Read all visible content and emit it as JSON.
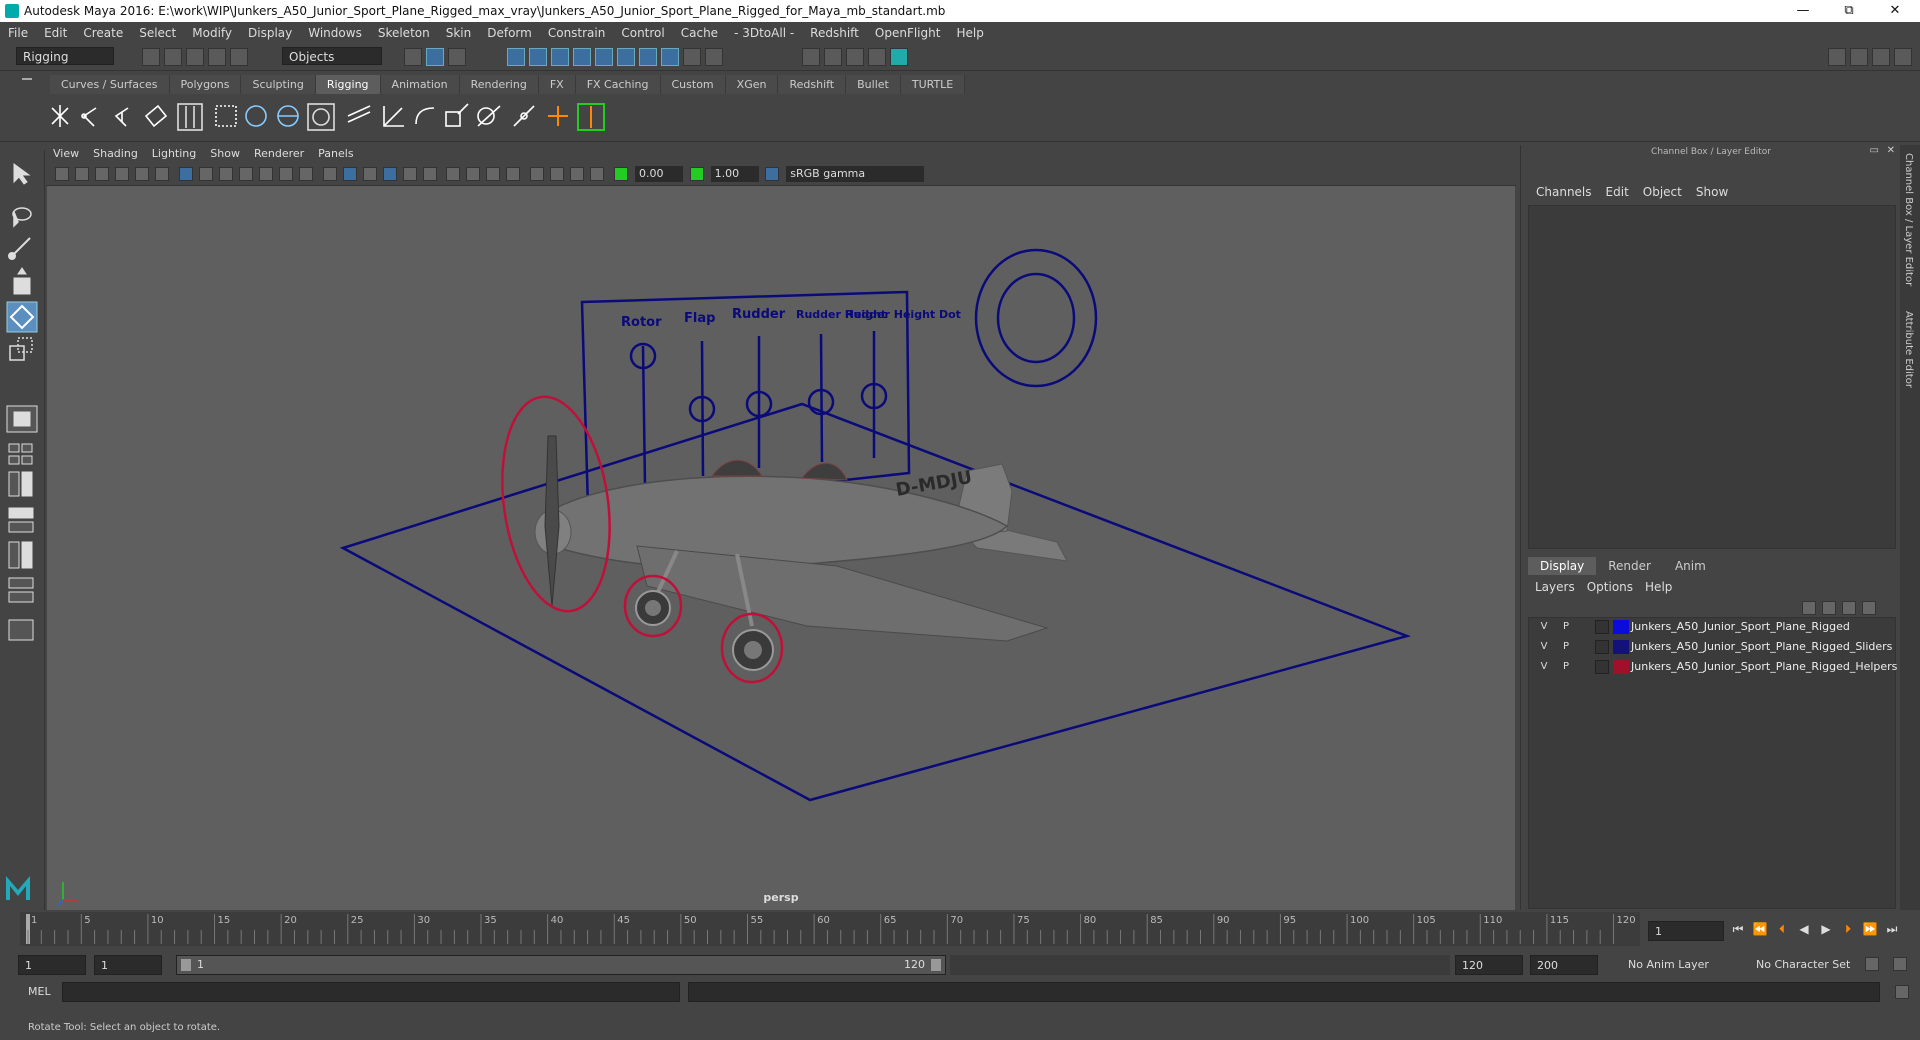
{
  "window": {
    "title": "Autodesk Maya 2016: E:\\work\\WIP\\Junkers_A50_Junior_Sport_Plane_Rigged_max_vray\\Junkers_A50_Junior_Sport_Plane_Rigged_for_Maya_mb_standart.mb",
    "minimize": "—",
    "restore": "⧉",
    "close": "✕"
  },
  "menu": [
    "File",
    "Edit",
    "Create",
    "Select",
    "Modify",
    "Display",
    "Windows",
    "Skeleton",
    "Skin",
    "Deform",
    "Constrain",
    "Control",
    "Cache",
    "- 3DtoAll -",
    "Redshift",
    "OpenFlight",
    "Help"
  ],
  "statusline": {
    "mode": "Rigging",
    "selection_mask": "Objects"
  },
  "shelf_tabs": [
    "Curves / Surfaces",
    "Polygons",
    "Sculpting",
    "Rigging",
    "Animation",
    "Rendering",
    "FX",
    "FX Caching",
    "Custom",
    "XGen",
    "Redshift",
    "Bullet",
    "TURTLE"
  ],
  "shelf_active": "Rigging",
  "panel_menu": [
    "View",
    "Shading",
    "Lighting",
    "Show",
    "Renderer",
    "Panels"
  ],
  "panel_toolbar": {
    "exposure": "0.00",
    "gamma": "1.00",
    "color_space": "sRGB gamma"
  },
  "viewport": {
    "camera_label": "persp",
    "slider_labels": [
      "Rotor",
      "Flap",
      "Rudder",
      "Rudder Height",
      "Rudder Height Dot"
    ],
    "plane_registration": "D-MDJU",
    "colors": {
      "rig_blue": "#0a0a7a",
      "helper_red": "#c0103a",
      "bg": "#5f5f5f"
    }
  },
  "right_panel": {
    "title": "Channel Box / Layer Editor",
    "cb_menu": [
      "Channels",
      "Edit",
      "Object",
      "Show"
    ],
    "le_tabs": [
      "Display",
      "Render",
      "Anim"
    ],
    "le_active": "Display",
    "le_menu": [
      "Layers",
      "Options",
      "Help"
    ],
    "layers": [
      {
        "v": "V",
        "p": "P",
        "color": "#0b0bdc",
        "name": "Junkers_A50_Junior_Sport_Plane_Rigged"
      },
      {
        "v": "V",
        "p": "P",
        "color": "#12127a",
        "name": "Junkers_A50_Junior_Sport_Plane_Rigged_Sliders"
      },
      {
        "v": "V",
        "p": "P",
        "color": "#a1102a",
        "name": "Junkers_A50_Junior_Sport_Plane_Rigged_Helpers"
      }
    ],
    "side_tabs": [
      "Channel Box / Layer Editor",
      "Attribute Editor"
    ]
  },
  "timeline": {
    "ticks": [
      "1",
      "5",
      "10",
      "15",
      "20",
      "25",
      "30",
      "35",
      "40",
      "45",
      "50",
      "55",
      "60",
      "65",
      "70",
      "75",
      "80",
      "85",
      "90",
      "95",
      "100",
      "105",
      "110",
      "115",
      "120"
    ],
    "current_frame": "1"
  },
  "range": {
    "start": "1",
    "inner_start": "1",
    "slider_start": "1",
    "slider_end": "120",
    "end": "120",
    "max": "200",
    "anim_layer": "No Anim Layer",
    "character_set": "No Character Set"
  },
  "cmdline": {
    "label": "MEL"
  },
  "helpline": {
    "text": "Rotate Tool: Select an object to rotate."
  }
}
